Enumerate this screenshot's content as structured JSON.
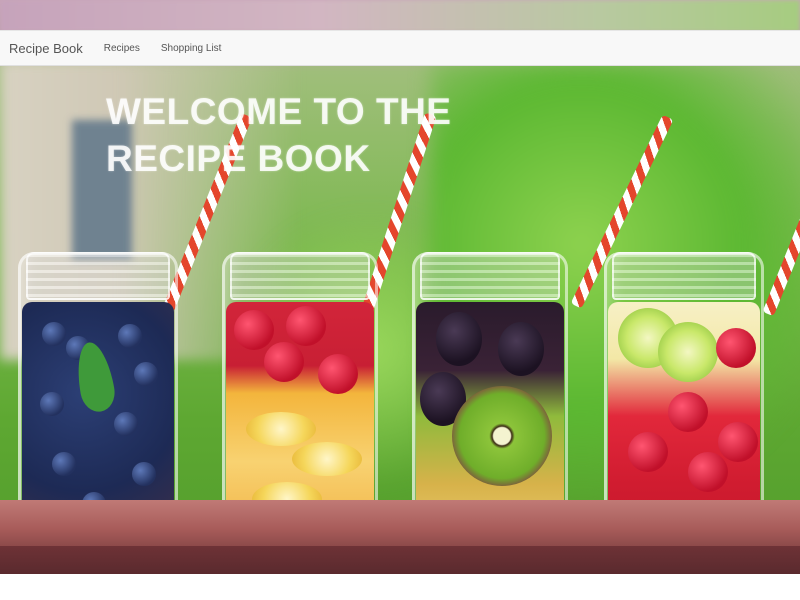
{
  "navbar": {
    "brand": "Recipe Book",
    "links": [
      {
        "label": "Recipes"
      },
      {
        "label": "Shopping List"
      }
    ]
  },
  "hero": {
    "title": "WELCOME TO THE RECIPE BOOK"
  },
  "colors": {
    "navbar_bg": "#f8f8f8",
    "nav_text": "#555555",
    "title_text": "#ffffff"
  }
}
